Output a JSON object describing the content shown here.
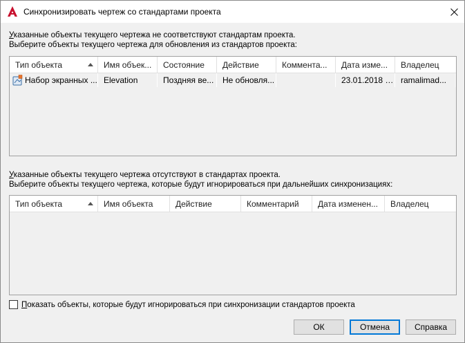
{
  "window": {
    "title": "Синхронизировать чертеж со стандартами проекта",
    "accent_color": "#c8102e"
  },
  "section1": {
    "line1_u": "У",
    "line1_rest": "казанные объекты текущего чертежа не соответствуют стандартам проекта.",
    "line2": "Выберите объекты текущего чертежа для обновления из стандартов проекта:",
    "columns": [
      "Тип объекта",
      "Имя объек...",
      "Состояние",
      "Действие",
      "Коммента...",
      "Дата изме...",
      "Владелец"
    ],
    "rows": [
      {
        "type": "Набор экранных ...",
        "name": "Elevation",
        "state": "Поздняя ве...",
        "action": "Не обновля...",
        "comment": "",
        "date": "23.01.2018 1...",
        "owner": "ramalimad..."
      }
    ]
  },
  "section2": {
    "line1_u": "У",
    "line1_rest": "казанные объекты текущего чертежа отсутствуют в стандартах проекта.",
    "line2": "Выберите объекты текущего чертежа, которые будут игнорироваться при дальнейших синхронизациях:",
    "columns": [
      "Тип объекта",
      "Имя объекта",
      "Действие",
      "Комментарий",
      "Дата изменен...",
      "Владелец"
    ]
  },
  "checkbox": {
    "label_u": "П",
    "label_rest": "оказать объекты, которые будут игнорироваться при синхронизации стандартов проекта",
    "checked": false
  },
  "buttons": {
    "ok": "ОК",
    "cancel": "Отмена",
    "help": "Справка"
  }
}
